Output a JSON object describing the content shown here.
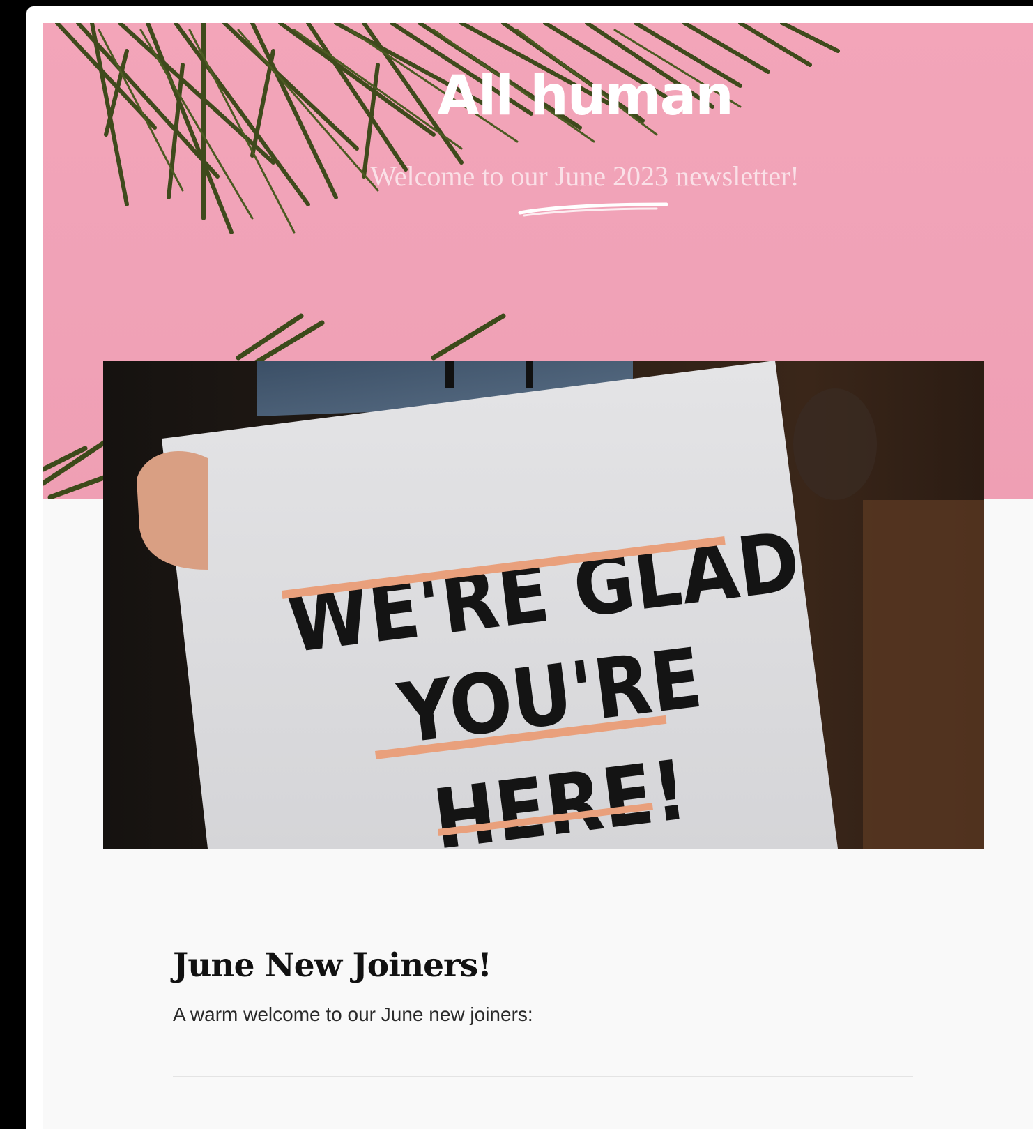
{
  "newsletter": {
    "hero": {
      "title": "All human",
      "subtitle": "Welcome to our June 2023 newsletter!"
    },
    "photo_sign": {
      "line1": "WE'RE GLAD",
      "line2": "YOU'RE",
      "line3": "HERE!"
    },
    "section": {
      "title": "June New Joiners!",
      "text": "A warm welcome to our June new joiners:"
    }
  },
  "colors": {
    "page_background": "#000000",
    "hero_pink": "#f0a2b7",
    "content_background": "#f9f9f9",
    "sign_underline": "#e9a07c",
    "palm_green": "#3f4a1c"
  },
  "icons": [
    "palm-leaves-illustration",
    "swoosh-underline"
  ]
}
